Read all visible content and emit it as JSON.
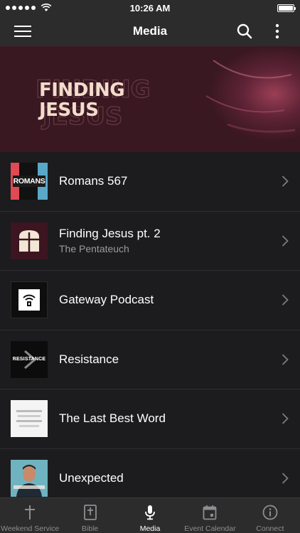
{
  "status_bar": {
    "time": "10:26 AM"
  },
  "nav": {
    "title": "Media",
    "icons": [
      "menu-icon",
      "search-icon",
      "more-vertical-icon"
    ]
  },
  "hero": {
    "title": "FINDING JESUS"
  },
  "media_items": [
    {
      "title": "Romans 567",
      "subtitle": "",
      "thumbnail_text": "ROMANS",
      "icon": "chevron-right-icon"
    },
    {
      "title": "Finding Jesus pt. 2",
      "subtitle": "The Pentateuch",
      "thumbnail_text": "",
      "icon": "chevron-right-icon"
    },
    {
      "title": "Gateway Podcast",
      "subtitle": "",
      "thumbnail_text": "",
      "icon": "chevron-right-icon"
    },
    {
      "title": "Resistance",
      "subtitle": "",
      "thumbnail_text": "RESISTANCE",
      "icon": "chevron-right-icon"
    },
    {
      "title": "The Last Best Word",
      "subtitle": "",
      "thumbnail_text": "",
      "icon": "chevron-right-icon"
    },
    {
      "title": "Unexpected",
      "subtitle": "",
      "thumbnail_text": "",
      "icon": "chevron-right-icon"
    }
  ],
  "tabs": [
    {
      "label": "Weekend Service",
      "icon": "cross-icon",
      "active": false
    },
    {
      "label": "Bible",
      "icon": "bible-icon",
      "active": false
    },
    {
      "label": "Media",
      "icon": "microphone-icon",
      "active": true
    },
    {
      "label": "Event Calendar",
      "icon": "calendar-icon",
      "active": false
    },
    {
      "label": "Connect",
      "icon": "info-icon",
      "active": false
    }
  ],
  "colors": {
    "background": "#1c1c1e",
    "bar": "#2c2c2c",
    "hero": "#3a1822",
    "active_tab": "#ffffff",
    "inactive_tab": "#8e8e93"
  }
}
